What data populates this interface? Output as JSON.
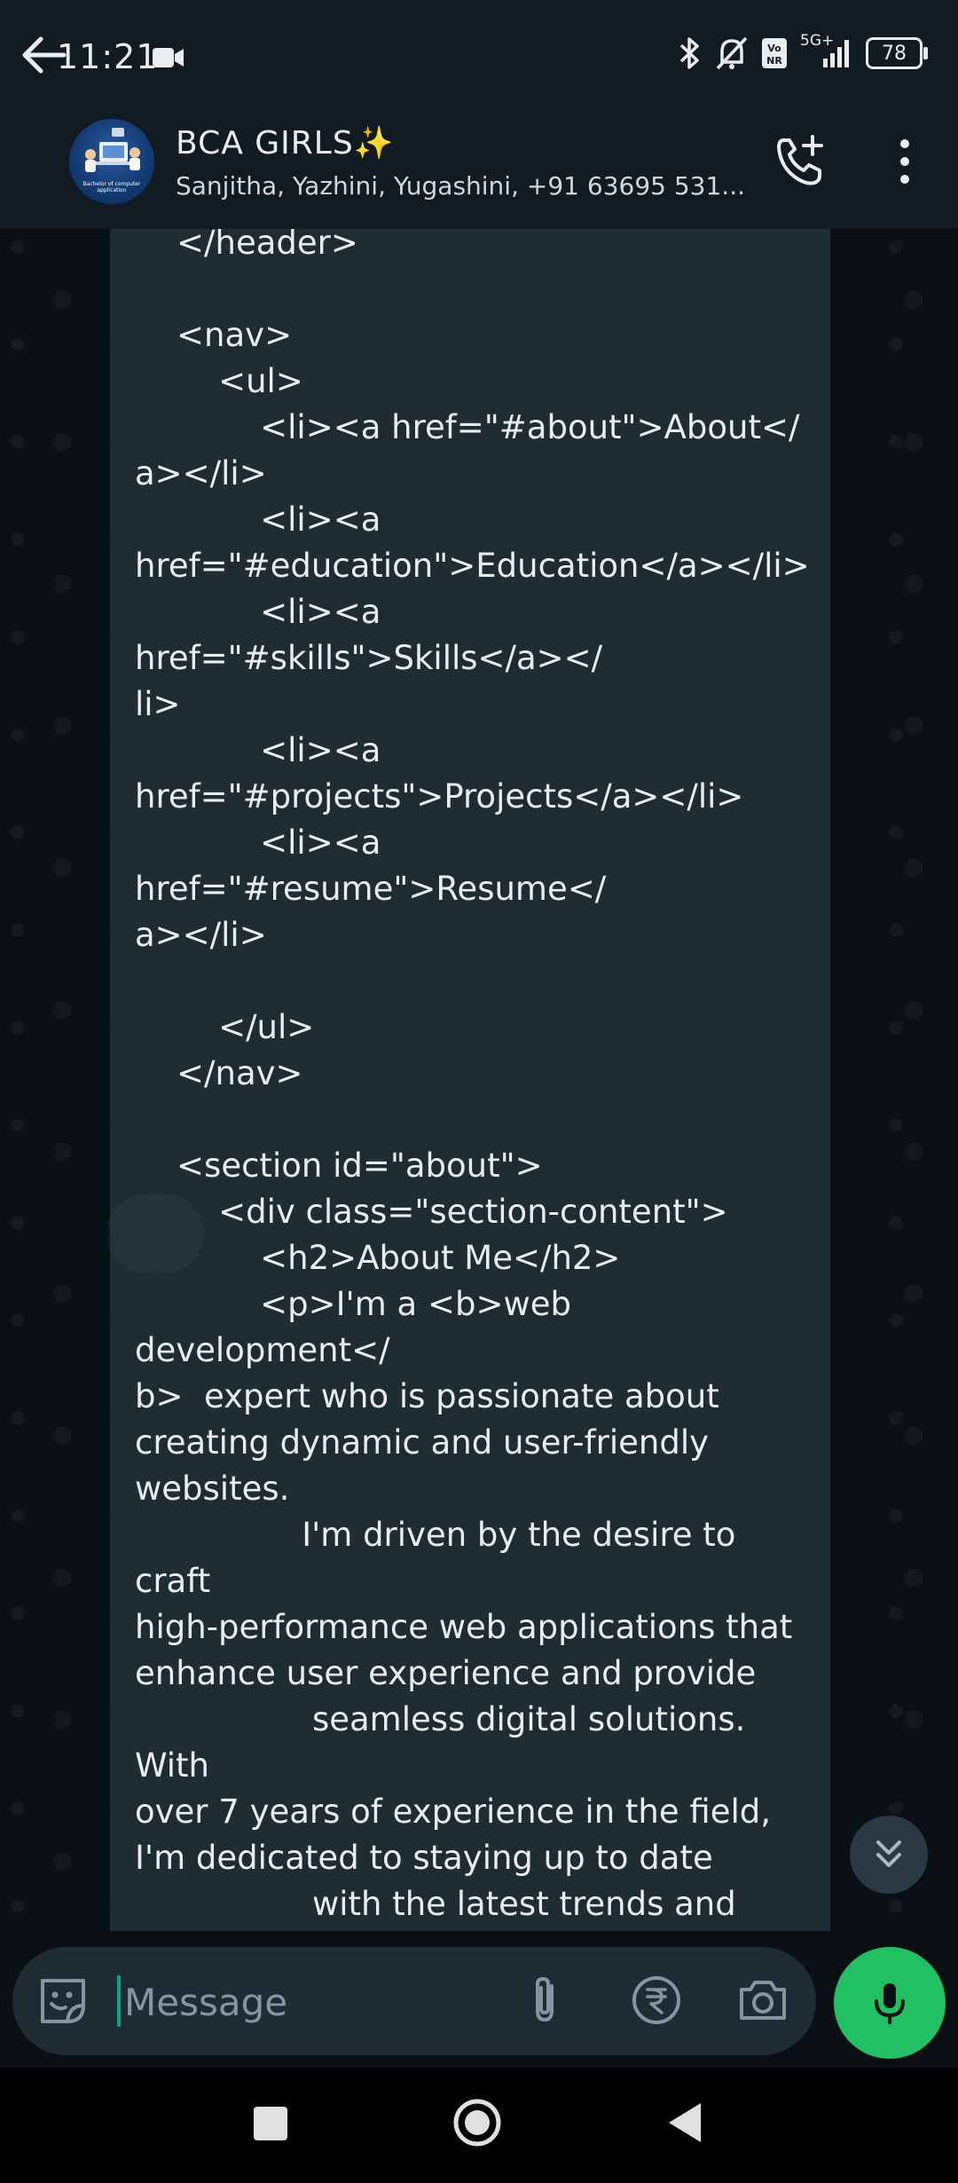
{
  "status_bar": {
    "time": "11:21",
    "network": "5G+",
    "battery": "78",
    "icons": [
      "video-camera-icon",
      "bluetooth-icon",
      "bell-muted-icon",
      "volte-icon",
      "signal-icon",
      "battery-icon"
    ]
  },
  "header": {
    "title": "BCA GIRLS✨",
    "subtitle": "Sanjitha, Yazhini, Yugashini, +91 63695 531...",
    "avatar_caption": "Bachelor of computer application"
  },
  "message": {
    "text": "    </header>\n\n    <nav>\n        <ul>\n            <li><a href=\"#about\">About</\na></li>\n            <li><a\nhref=\"#education\">Education</a></li>\n            <li><a href=\"#skills\">Skills</a></\nli>\n            <li><a\nhref=\"#projects\">Projects</a></li>\n            <li><a href=\"#resume\">Resume</\na></li>\n\n        </ul>\n    </nav>\n\n    <section id=\"about\">\n        <div class=\"section-content\">\n            <h2>About Me</h2>\n            <p>I'm a <b>web development</\nb>  expert who is passionate about\ncreating dynamic and user-friendly\nwebsites.\n                I'm driven by the desire to craft\nhigh-performance web applications that\nenhance user experience and provide\n                 seamless digital solutions. With\nover 7 years of experience in the field,\nI'm dedicated to staying up to date\n                 with the latest trends and\ninnovations in the\n                 web development landscape.\nI'm also committed to helping others\nlearn more about web technologies,\n                 best practices, and how to"
  },
  "composer": {
    "placeholder": "Message"
  },
  "colors": {
    "header_bg": "#121b22",
    "chat_bg": "#0b1014",
    "bubble_bg": "#1f2c33",
    "accent": "#00a884",
    "mic_fab": "#21c063"
  }
}
